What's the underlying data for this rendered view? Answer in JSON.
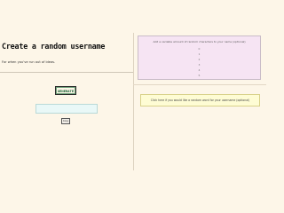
{
  "header": {
    "title": "Create a random username",
    "subtitle": "For when you've run out of ideas."
  },
  "actions": {
    "generate_label": "GENERATE",
    "copy_label": "Copy"
  },
  "username_field": {
    "value": "",
    "placeholder": ""
  },
  "random_panel": {
    "heading": "Add a variable amount of random characters to your name (optional)",
    "options": [
      "0",
      "1",
      "2",
      "3",
      "4",
      "5"
    ]
  },
  "hint": {
    "text": "Click here if you would like a random word for your username (optional)"
  },
  "colors": {
    "background": "#fdf6e8",
    "panel_pink": "#f6e4f3",
    "input_cyan": "#e9f8f7",
    "hint_yellow": "#fefcd4",
    "button_text_green": "#0c5a2c"
  }
}
